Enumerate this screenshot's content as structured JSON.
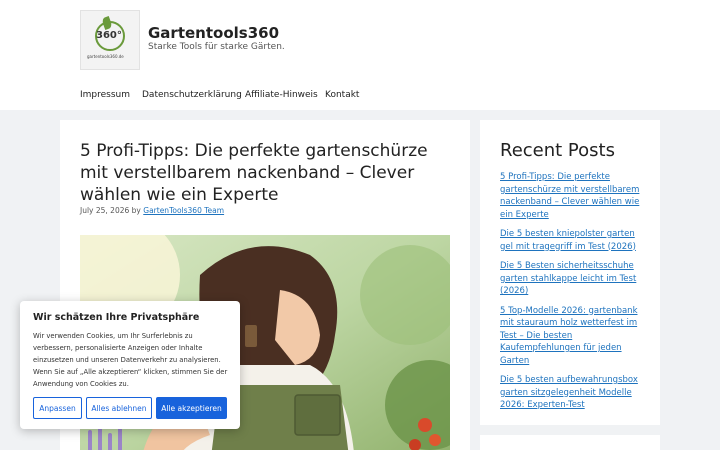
{
  "header": {
    "logo_text": "360°",
    "logo_subtext": "gartentools360.de",
    "site_title": "Gartentools360",
    "tagline": "Starke Tools für starke Gärten."
  },
  "nav": {
    "items": [
      {
        "label": "Impressum"
      },
      {
        "label": "Datenschutzerklärung"
      },
      {
        "label": "Affiliate-Hinweis"
      },
      {
        "label": "Kontakt"
      }
    ]
  },
  "post": {
    "title": "5 Profi-Tipps: Die perfekte gartenschürze mit verstellbarem nackenband – Clever wählen wie ein Experte",
    "date": "July 25, 2026",
    "by": "by",
    "author": "GartenTools360 Team"
  },
  "sidebar": {
    "widget_title": "Recent Posts",
    "recent_posts": [
      {
        "label": "5 Profi-Tipps: Die perfekte gartenschürze mit verstellbarem nackenband – Clever wählen wie ein Experte"
      },
      {
        "label": "Die 5 besten kniepolster garten gel mit tragegriff im Test (2026)"
      },
      {
        "label": "Die 5 Besten sicherheitsschuhe garten stahlkappe leicht im Test (2026)"
      },
      {
        "label": "5 Top-Modelle 2026: gartenbank mit stauraum holz wetterfest im Test – Die besten Kaufempfehlungen für jeden Garten"
      },
      {
        "label": "Die 5 besten aufbewahrungsbox garten sitzgelegenheit Modelle 2026: Experten-Test"
      }
    ]
  },
  "cookie": {
    "title": "Wir schätzen Ihre Privatsphäre",
    "text": "Wir verwenden Cookies, um Ihr Surferlebnis zu verbessern, personalisierte Anzeigen oder Inhalte einzusetzen und unseren Datenverkehr zu analysieren. Wenn Sie auf „Alle akzeptieren“ klicken, stimmen Sie der Anwendung von Cookies zu.",
    "customize_label": "Anpassen",
    "reject_label": "Alles ablehnen",
    "accept_label": "Alle akzeptieren"
  },
  "colors": {
    "link": "#1e73be",
    "accent_button": "#1863dc",
    "page_background": "#f0f2f4"
  }
}
